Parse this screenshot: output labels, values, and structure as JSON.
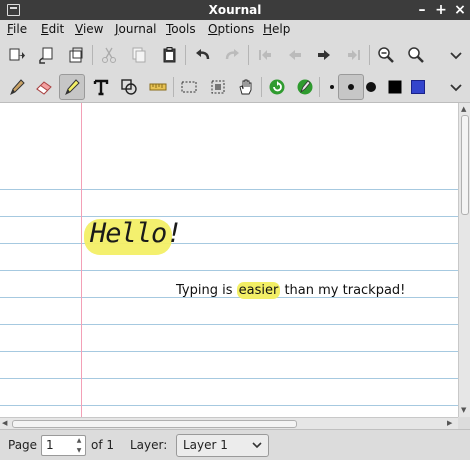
{
  "window": {
    "title": "Xournal",
    "buttons": [
      "–",
      "+",
      "×"
    ]
  },
  "menu": [
    {
      "label": "File",
      "mnemonic": "F",
      "rest": "ile"
    },
    {
      "label": "Edit",
      "mnemonic": "E",
      "rest": "dit"
    },
    {
      "label": "View",
      "mnemonic": "V",
      "rest": "iew"
    },
    {
      "label": "Journal",
      "mnemonic": "J",
      "rest": "ournal"
    },
    {
      "label": "Tools",
      "mnemonic": "T",
      "rest": "ools"
    },
    {
      "label": "Options",
      "mnemonic": "O",
      "rest": "ptions"
    },
    {
      "label": "Help",
      "mnemonic": "H",
      "rest": "elp"
    }
  ],
  "toolbar_main": [
    "save-icon",
    "new-page-icon",
    "open-icon",
    "cut-icon",
    "copy-icon",
    "paste-icon",
    "undo-icon",
    "redo-icon",
    "first-page-icon",
    "previous-page-icon",
    "next-page-icon",
    "last-page-icon",
    "zoom-out-icon",
    "zoom-icon",
    "more-icon"
  ],
  "toolbar_tools": [
    "pen-icon",
    "eraser-icon",
    "highlighter-icon",
    "text-icon",
    "shapes-icon",
    "ruler-icon",
    "select-rectangle-icon",
    "select-region-icon",
    "hand-icon",
    "default-tool-icon",
    "tool-settings-icon",
    "thin-dot-icon",
    "medium-dot-icon",
    "thick-dot-icon",
    "black-color-icon",
    "blue-color-icon",
    "more-icon"
  ],
  "colors": {
    "highlight": "#f3ef66",
    "margin": "#f3a0b6",
    "rule": "#a6c9e0",
    "blue_swatch": "#3344cc",
    "title_bar": "#3c3c3c"
  },
  "page": {
    "handwritten": "Hello!",
    "typed_before": "Typing is ",
    "typed_highlight": "easier",
    "typed_after": " than my trackpad!"
  },
  "status": {
    "page_label": "Page",
    "page_value": "1",
    "of_label": "of 1",
    "layer_label": "Layer:",
    "layer_value": "Layer 1"
  }
}
